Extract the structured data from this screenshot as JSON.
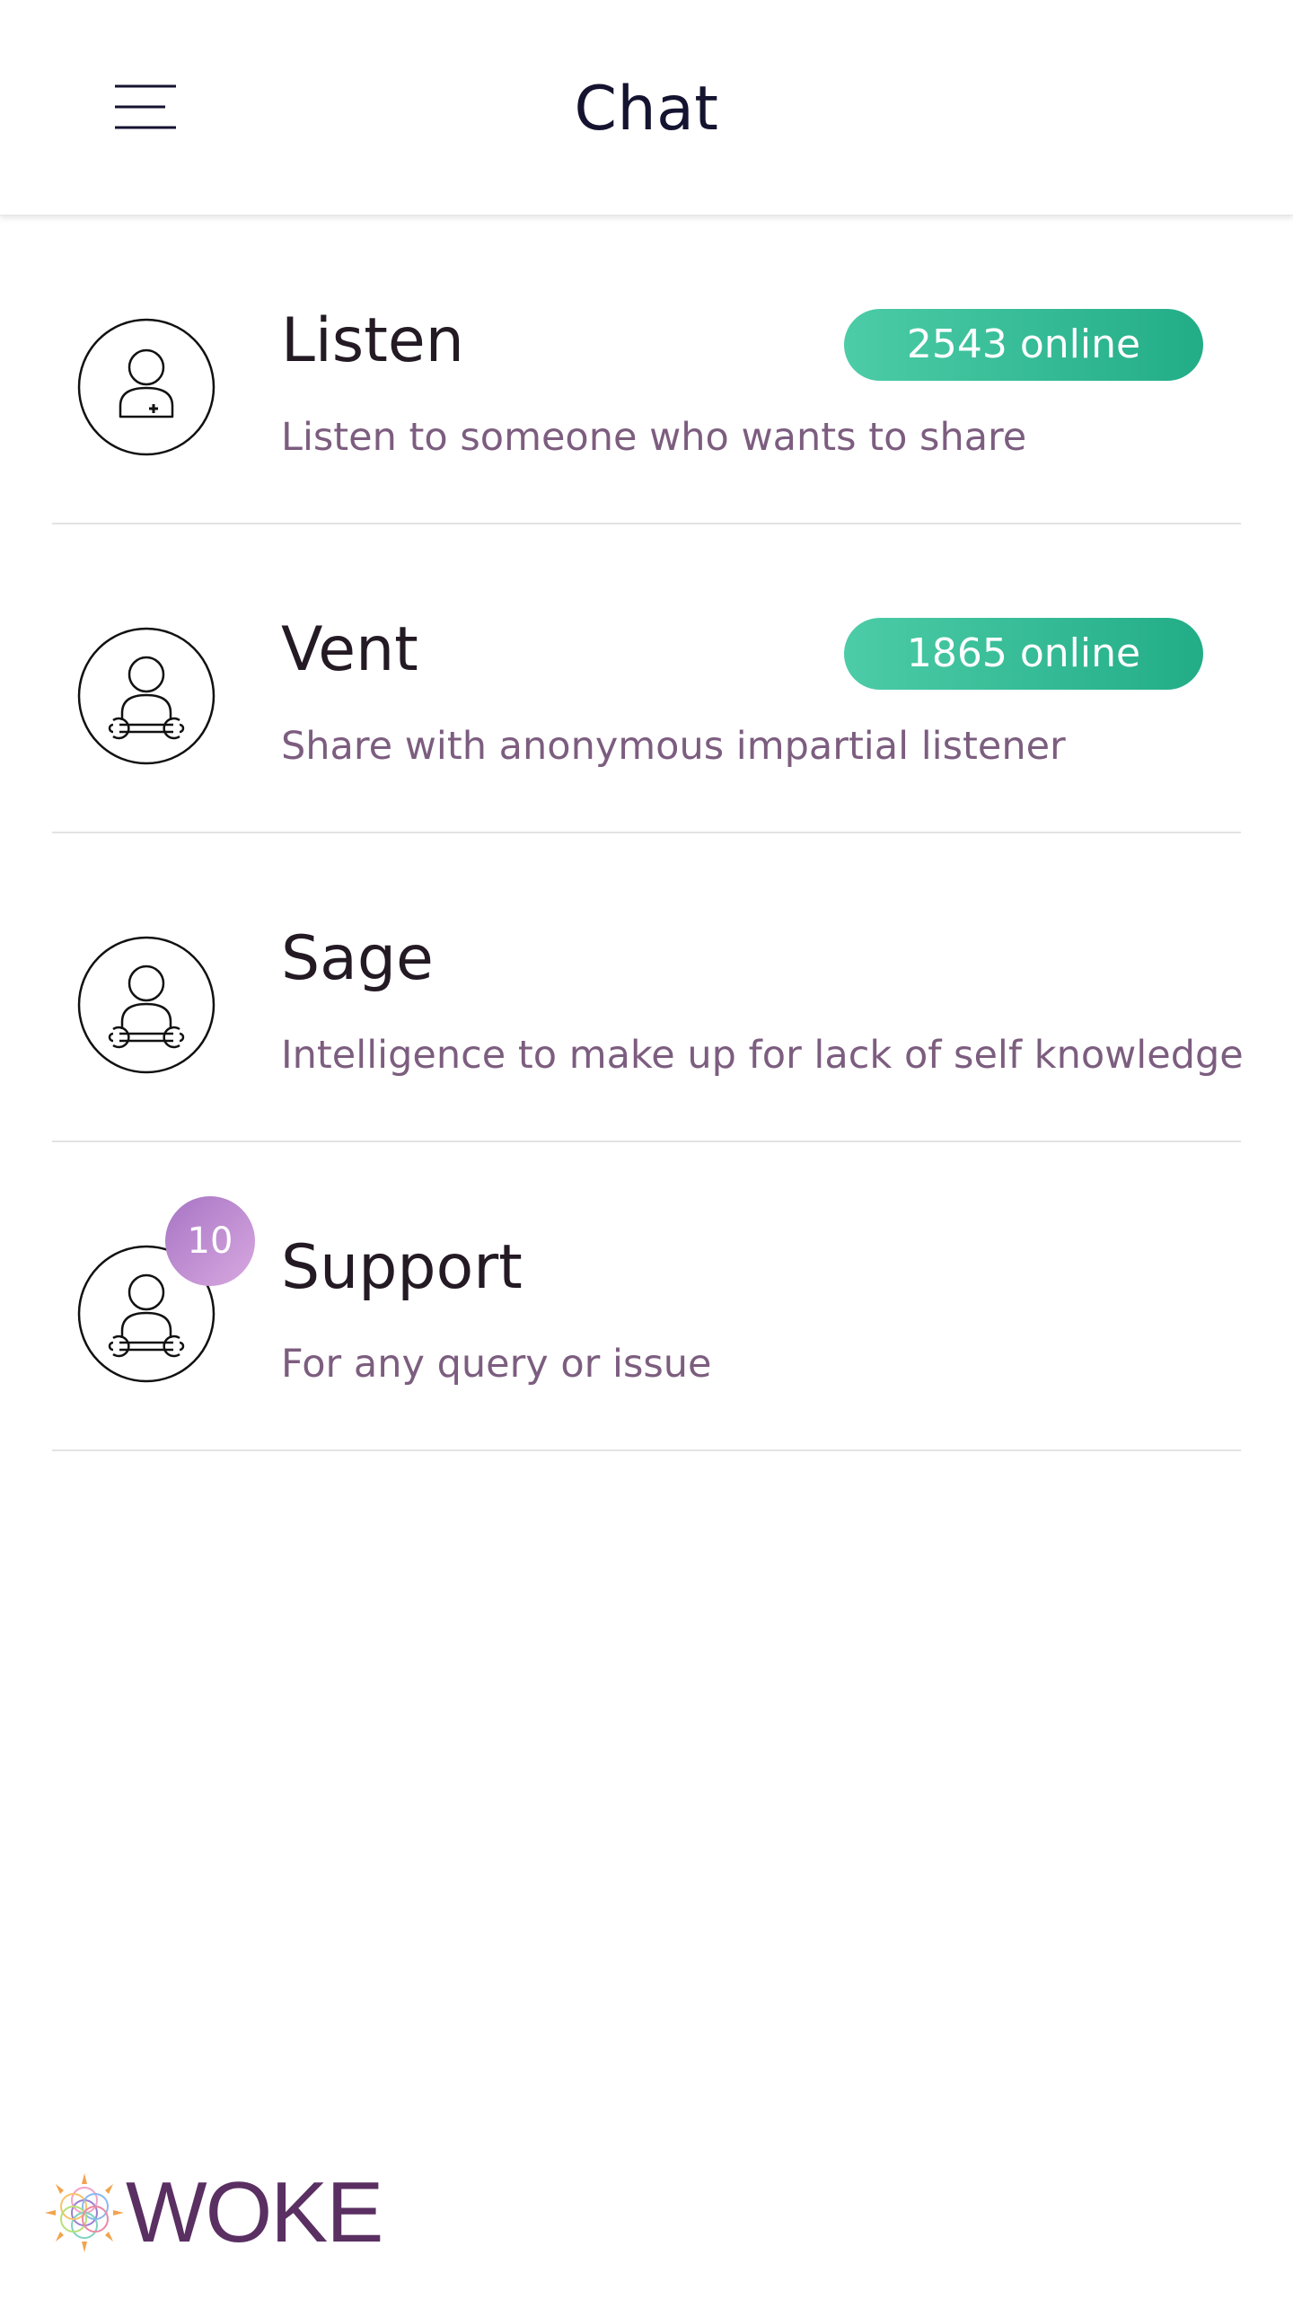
{
  "header": {
    "title": "Chat",
    "menu_icon": "hamburger-menu-icon"
  },
  "items": [
    {
      "title": "Listen",
      "subtitle": "Listen to someone who wants to share",
      "online": "2543 online",
      "icon": "user-plus-icon"
    },
    {
      "title": "Vent",
      "subtitle": "Share with anonymous impartial listener",
      "online": "1865 online",
      "icon": "user-wrench-icon"
    },
    {
      "title": "Sage",
      "subtitle": "Intelligence to make up for lack of self knowledge",
      "icon": "user-wrench-icon"
    },
    {
      "title": "Support",
      "subtitle": "For any query or issue",
      "badge": "10",
      "icon": "user-wrench-icon"
    }
  ],
  "footer": {
    "logo_text": "WOKE"
  },
  "colors": {
    "title": "#141330",
    "item_title": "#231a24",
    "subtitle": "#7c5d7f",
    "online_pill": "#2eb992",
    "badge": "#b98ad0",
    "logo": "#5a2f62"
  }
}
